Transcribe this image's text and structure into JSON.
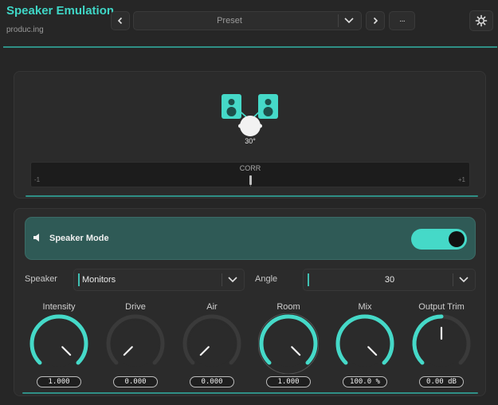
{
  "header": {
    "title": "Speaker Emulation",
    "subtitle": "produc.ing",
    "preset_label": "Preset",
    "more_label": "···"
  },
  "visual": {
    "angle_label": "30°",
    "corr": {
      "label": "CORR",
      "min": "-1",
      "max": "+1"
    }
  },
  "mode": {
    "label": "Speaker Mode",
    "enabled": true
  },
  "speaker": {
    "label": "Speaker",
    "value": "Monitors"
  },
  "angle": {
    "label": "Angle",
    "value": "30"
  },
  "knobs": [
    {
      "name": "Intensity",
      "value": "1.000",
      "level": 1.0
    },
    {
      "name": "Drive",
      "value": "0.000",
      "level": 0.0
    },
    {
      "name": "Air",
      "value": "0.000",
      "level": 0.0
    },
    {
      "name": "Room",
      "value": "1.000",
      "level": 1.0
    },
    {
      "name": "Mix",
      "value": "100.0 %",
      "level": 1.0
    },
    {
      "name": "Output Trim",
      "value": "0.00 dB",
      "level": 0.5
    }
  ],
  "colors": {
    "accent": "#45d9c8",
    "track": "#3a3a3a",
    "mode_bg": "#2f5a56"
  }
}
